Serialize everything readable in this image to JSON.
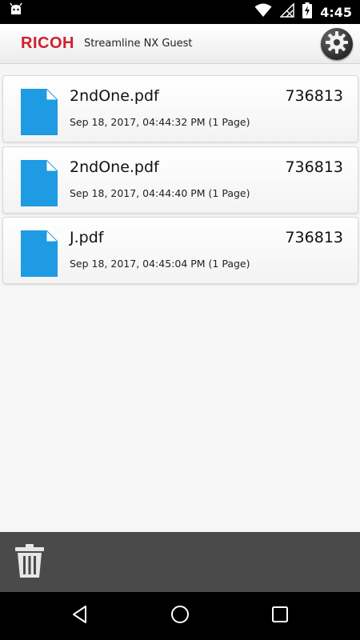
{
  "status_bar": {
    "time": "4:45",
    "icons": [
      "android-debug-icon",
      "wifi-icon",
      "no-signal-icon",
      "battery-charging-icon"
    ]
  },
  "header": {
    "brand": "RICOH",
    "title": "Streamline NX Guest",
    "settings_icon": "gear-icon"
  },
  "files": [
    {
      "name": "2ndOne.pdf",
      "size": "736813",
      "date": "Sep 18, 2017, 04:44:32 PM (1 Page)"
    },
    {
      "name": "2ndOne.pdf",
      "size": "736813",
      "date": "Sep 18, 2017, 04:44:40 PM (1 Page)"
    },
    {
      "name": "J.pdf",
      "size": "736813",
      "date": "Sep 18, 2017, 04:45:04 PM (1 Page)"
    }
  ],
  "toolbar": {
    "delete_icon": "trash-icon"
  },
  "nav": {
    "icons": [
      "back-icon",
      "home-icon",
      "recents-icon"
    ]
  },
  "colors": {
    "brand_red": "#cf1f2e",
    "file_icon_blue": "#1e9be2",
    "toolbar_gray": "#4a4a4a"
  }
}
